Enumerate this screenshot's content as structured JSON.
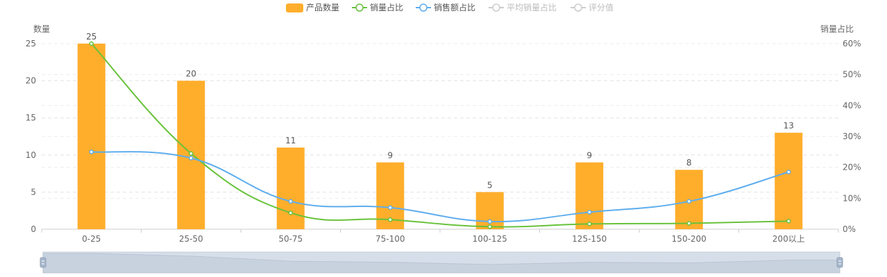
{
  "chart_data": {
    "type": "bar",
    "categories": [
      "0-25",
      "25-50",
      "50-75",
      "75-100",
      "100-125",
      "125-150",
      "150-200",
      "200以上"
    ],
    "series": [
      {
        "name": "产品数量",
        "type": "bar",
        "axis": "left",
        "values": [
          25,
          20,
          11,
          9,
          5,
          9,
          8,
          13
        ],
        "color": "#FFAE2C",
        "visible": true,
        "labels": true
      },
      {
        "name": "销量占比",
        "type": "line",
        "axis": "right",
        "values": [
          60,
          24.5,
          5.3,
          3.1,
          0.8,
          1.7,
          1.9,
          2.6
        ],
        "color": "#67C23A",
        "visible": true
      },
      {
        "name": "销售额占比",
        "type": "line",
        "axis": "right",
        "values": [
          25,
          23,
          9,
          7,
          2.5,
          5.5,
          9,
          18.5
        ],
        "color": "#5DADEE",
        "visible": true
      },
      {
        "name": "平均销量占比",
        "type": "line",
        "axis": "right",
        "values": [],
        "color": "#CCCCCC",
        "visible": false
      },
      {
        "name": "评分值",
        "type": "line",
        "axis": "right",
        "values": [],
        "color": "#CCCCCC",
        "visible": false
      }
    ],
    "y_left": {
      "label": "数量",
      "ylim": [
        0,
        25
      ],
      "ticks": [
        "0",
        "5",
        "10",
        "15",
        "20",
        "25"
      ]
    },
    "y_right": {
      "label": "销量占比",
      "ylim": [
        0,
        60
      ],
      "ticks": [
        "0%",
        "10%",
        "20%",
        "30%",
        "40%",
        "50%",
        "60%"
      ]
    },
    "grid": true,
    "legend": "top-center",
    "data_zoom": true
  }
}
